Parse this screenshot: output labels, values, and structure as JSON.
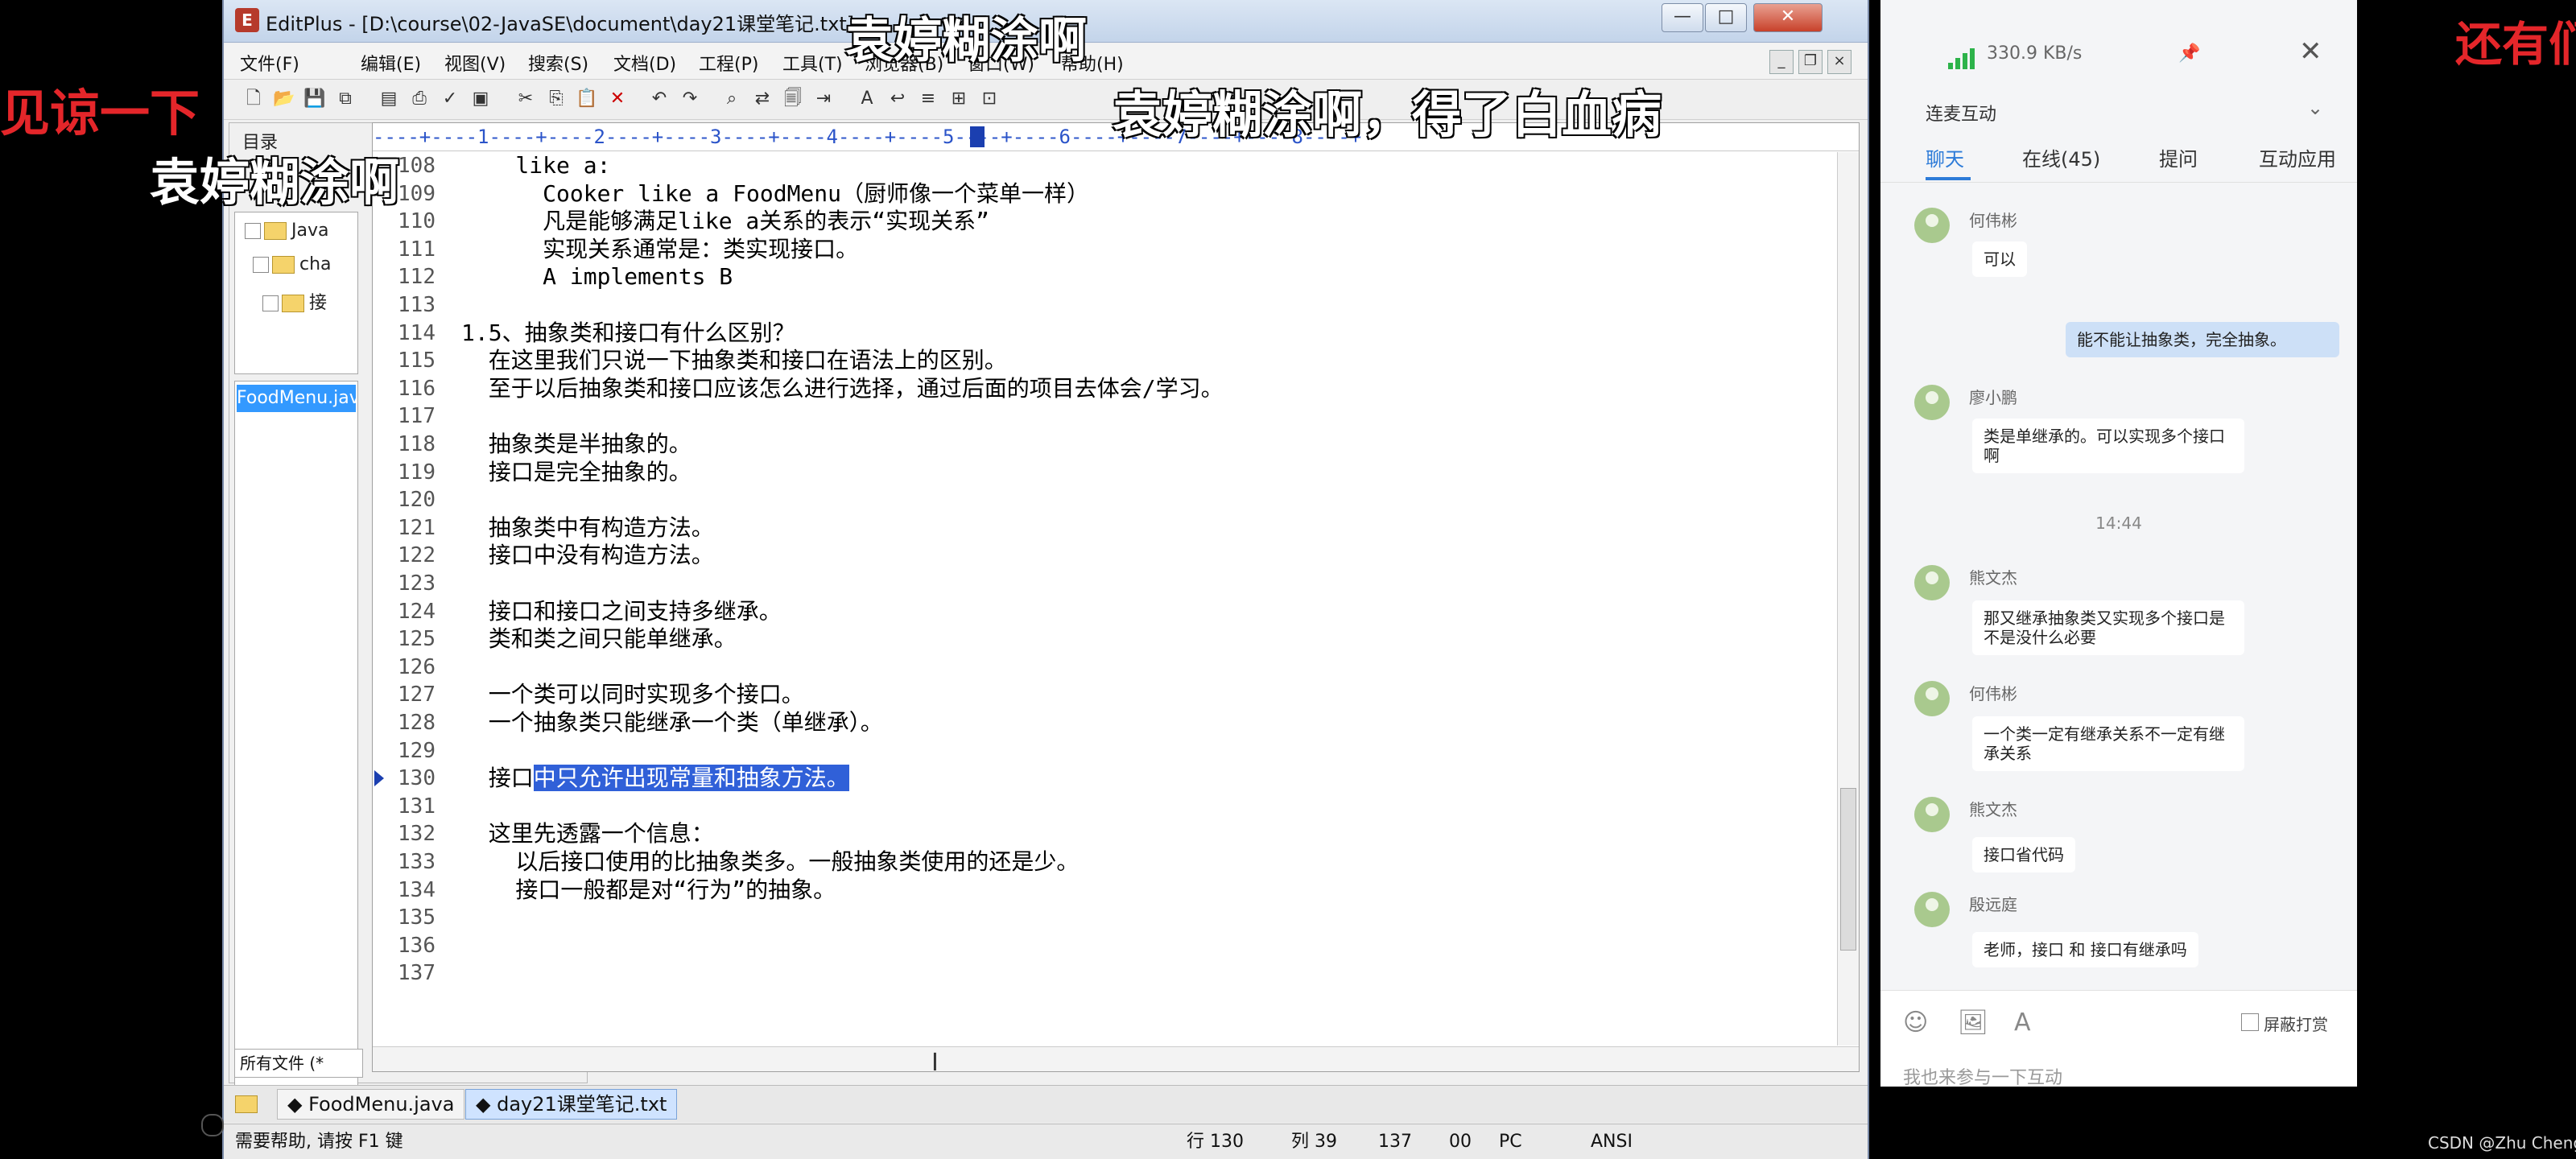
{
  "window": {
    "title": "EditPlus - [D:\\course\\02-JavaSE\\document\\day21课堂笔记.txt]",
    "buttons": {
      "minimize": "—",
      "maximize": "□",
      "close": "✕"
    }
  },
  "menu": [
    {
      "label": "文件(F)"
    },
    {
      "label": "编辑(E)"
    },
    {
      "label": "视图(V)"
    },
    {
      "label": "搜索(S)"
    },
    {
      "label": "文档(D)"
    },
    {
      "label": "工程(P)"
    },
    {
      "label": "工具(T)"
    },
    {
      "label": "浏览器(B)"
    },
    {
      "label": "窗口(W)"
    },
    {
      "label": "帮助(H)"
    }
  ],
  "directory": {
    "label": "目录",
    "tree": [
      "Java",
      "cha",
      "接"
    ],
    "selected_file": "FoodMenu.java",
    "filter": "所有文件 (*"
  },
  "ruler": "----+----1----+----2----+----3----+----4----+----5----+----6----+----7----+----8----+",
  "editor": {
    "lines": [
      {
        "num": "108",
        "text": "    like a:"
      },
      {
        "num": "109",
        "text": "      Cooker like a FoodMenu（厨师像一个菜单一样）"
      },
      {
        "num": "110",
        "text": "      凡是能够满足like a关系的表示“实现关系”"
      },
      {
        "num": "111",
        "text": "      实现关系通常是：类实现接口。"
      },
      {
        "num": "112",
        "text": "      A implements B"
      },
      {
        "num": "113",
        "text": ""
      },
      {
        "num": "114",
        "text": "1.5、抽象类和接口有什么区别？"
      },
      {
        "num": "115",
        "text": "  在这里我们只说一下抽象类和接口在语法上的区别。"
      },
      {
        "num": "116",
        "text": "  至于以后抽象类和接口应该怎么进行选择，通过后面的项目去体会/学习。"
      },
      {
        "num": "117",
        "text": ""
      },
      {
        "num": "118",
        "text": "  抽象类是半抽象的。"
      },
      {
        "num": "119",
        "text": "  接口是完全抽象的。"
      },
      {
        "num": "120",
        "text": ""
      },
      {
        "num": "121",
        "text": "  抽象类中有构造方法。"
      },
      {
        "num": "122",
        "text": "  接口中没有构造方法。"
      },
      {
        "num": "123",
        "text": ""
      },
      {
        "num": "124",
        "text": "  接口和接口之间支持多继承。"
      },
      {
        "num": "125",
        "text": "  类和类之间只能单继承。"
      },
      {
        "num": "126",
        "text": ""
      },
      {
        "num": "127",
        "text": "  一个类可以同时实现多个接口。"
      },
      {
        "num": "128",
        "text": "  一个抽象类只能继承一个类（单继承）。"
      },
      {
        "num": "129",
        "text": ""
      },
      {
        "num": "130",
        "text": "  接口",
        "selected": "中只允许出现常量和抽象方法。"
      },
      {
        "num": "131",
        "text": ""
      },
      {
        "num": "132",
        "text": "  这里先透露一个信息："
      },
      {
        "num": "133",
        "text": "    以后接口使用的比抽象类多。一般抽象类使用的还是少。"
      },
      {
        "num": "134",
        "text": "    接口一般都是对“行为”的抽象。"
      },
      {
        "num": "135",
        "text": ""
      },
      {
        "num": "136",
        "text": ""
      },
      {
        "num": "137",
        "text": ""
      }
    ]
  },
  "tabs": [
    {
      "label": "FoodMenu.java",
      "active": false
    },
    {
      "label": "day21课堂笔记.txt",
      "active": true
    }
  ],
  "status": {
    "help": "需要帮助, 请按 F1 键",
    "row": "行 130",
    "col": "列 39",
    "total": "137",
    "code": "00",
    "mode": "PC",
    "encoding": "ANSI"
  },
  "live": {
    "speed": "330.9 KB/s",
    "subtitle": "连麦互动",
    "tabs": [
      {
        "label": "聊天",
        "active": true
      },
      {
        "label": "在线(45)",
        "active": false
      },
      {
        "label": "提问",
        "active": false
      },
      {
        "label": "互动应用",
        "active": false
      }
    ],
    "messages": [
      {
        "name": "何伟彬",
        "text": "可以"
      },
      {
        "mine": true,
        "text": "能不能让抽象类，完全抽象。"
      },
      {
        "name": "廖小鹏",
        "text": "类是单继承的。可以实现多个接口啊"
      },
      {
        "time": "14:44"
      },
      {
        "name": "熊文杰",
        "text": "那又继承抽象类又实现多个接口是不是没什么必要"
      },
      {
        "name": "何伟彬",
        "text": "一个类一定有继承关系不一定有继承关系"
      },
      {
        "name": "熊文杰",
        "text": "接口省代码"
      },
      {
        "name": "殷远庭",
        "text": "老师，接口 和 接口有继承吗"
      }
    ],
    "mute_label": "屏蔽打赏",
    "input_placeholder": "我也来参与一下互动"
  },
  "danmaku": [
    {
      "text": "袁婷糊涂啊",
      "color": "white"
    },
    {
      "text": "见谅一下",
      "color": "red"
    },
    {
      "text": "袁婷糊涂啊",
      "color": "white"
    },
    {
      "text": "袁婷糊涂啊，得了白血病",
      "color": "white"
    },
    {
      "text": "还有们",
      "color": "red"
    }
  ],
  "watermark": "CSDN @Zhu Cheng"
}
